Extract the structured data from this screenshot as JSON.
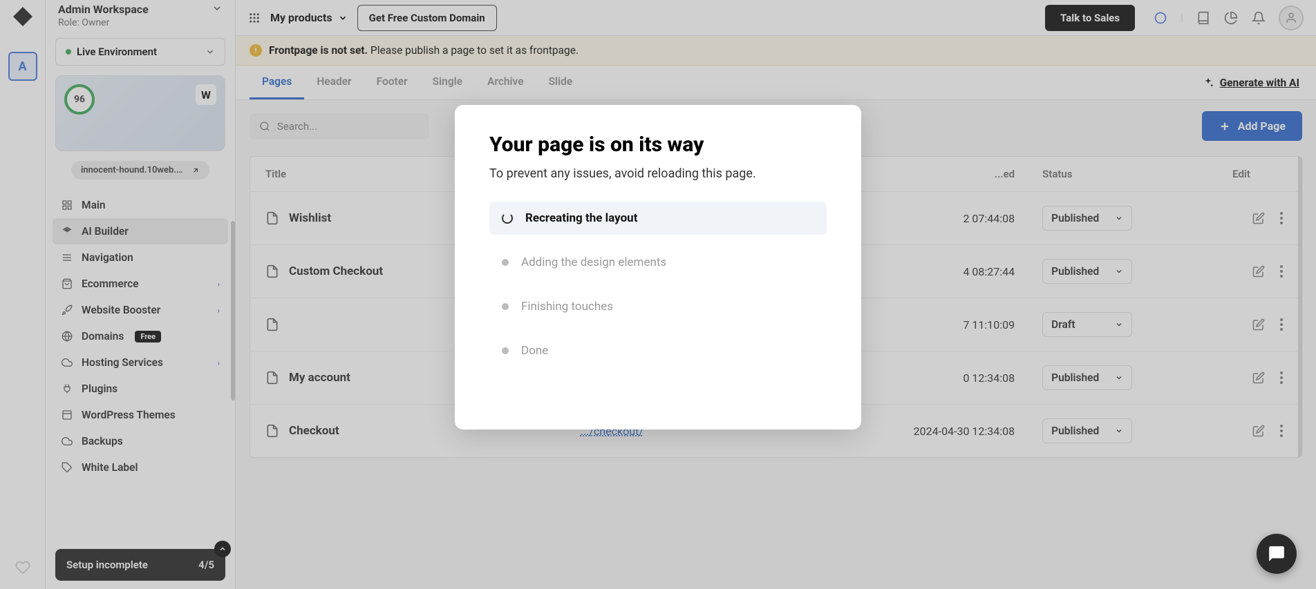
{
  "rail": {
    "avatar_letter": "A"
  },
  "workspace": {
    "title": "Admin Workspace",
    "role": "Role: Owner"
  },
  "environment": {
    "label": "Live Environment"
  },
  "score": "96",
  "preview_w": "W",
  "domain_chip": "innocent-hound.10web.c...",
  "nav": {
    "main": "Main",
    "ai_builder": "AI Builder",
    "navigation": "Navigation",
    "ecommerce": "Ecommerce",
    "website_booster": "Website Booster",
    "domains": "Domains",
    "domains_badge": "Free",
    "hosting": "Hosting Services",
    "plugins": "Plugins",
    "themes": "WordPress Themes",
    "backups": "Backups",
    "white_label": "White Label"
  },
  "setup": {
    "label": "Setup incomplete",
    "progress": "4/5"
  },
  "topbar": {
    "my_products": "My products",
    "custom_domain": "Get Free Custom Domain",
    "talk_to_sales": "Talk to Sales"
  },
  "banner": {
    "strong": "Frontpage is not set.",
    "rest": "Please publish a page to set it as frontpage."
  },
  "tabs": {
    "pages": "Pages",
    "header": "Header",
    "footer": "Footer",
    "single": "Single",
    "archive": "Archive",
    "slide": "Slide"
  },
  "generate_ai": "Generate with AI",
  "search_placeholder": "Search...",
  "add_page": "Add Page",
  "thead": {
    "title": "Title",
    "modified": "...ed",
    "status": "Status",
    "edit": "Edit"
  },
  "rows": [
    {
      "title": "Wishlist",
      "slug": "",
      "modified": "2 07:44:08",
      "status": "Published"
    },
    {
      "title": "Custom Checkout",
      "slug": "",
      "modified": "4 08:27:44",
      "status": "Published"
    },
    {
      "title": "",
      "slug": "",
      "modified": "7 11:10:09",
      "status": "Draft"
    },
    {
      "title": "My account",
      "slug": "",
      "modified": "0 12:34:08",
      "status": "Published"
    },
    {
      "title": "Checkout",
      "slug": ".../checkout/",
      "modified": "2024-04-30 12:34:08",
      "status": "Published"
    }
  ],
  "modal": {
    "title": "Your page is on its way",
    "subtitle": "To prevent any issues, avoid reloading this page.",
    "steps": {
      "s1": "Recreating the layout",
      "s2": "Adding the design elements",
      "s3": "Finishing touches",
      "s4": "Done"
    }
  }
}
